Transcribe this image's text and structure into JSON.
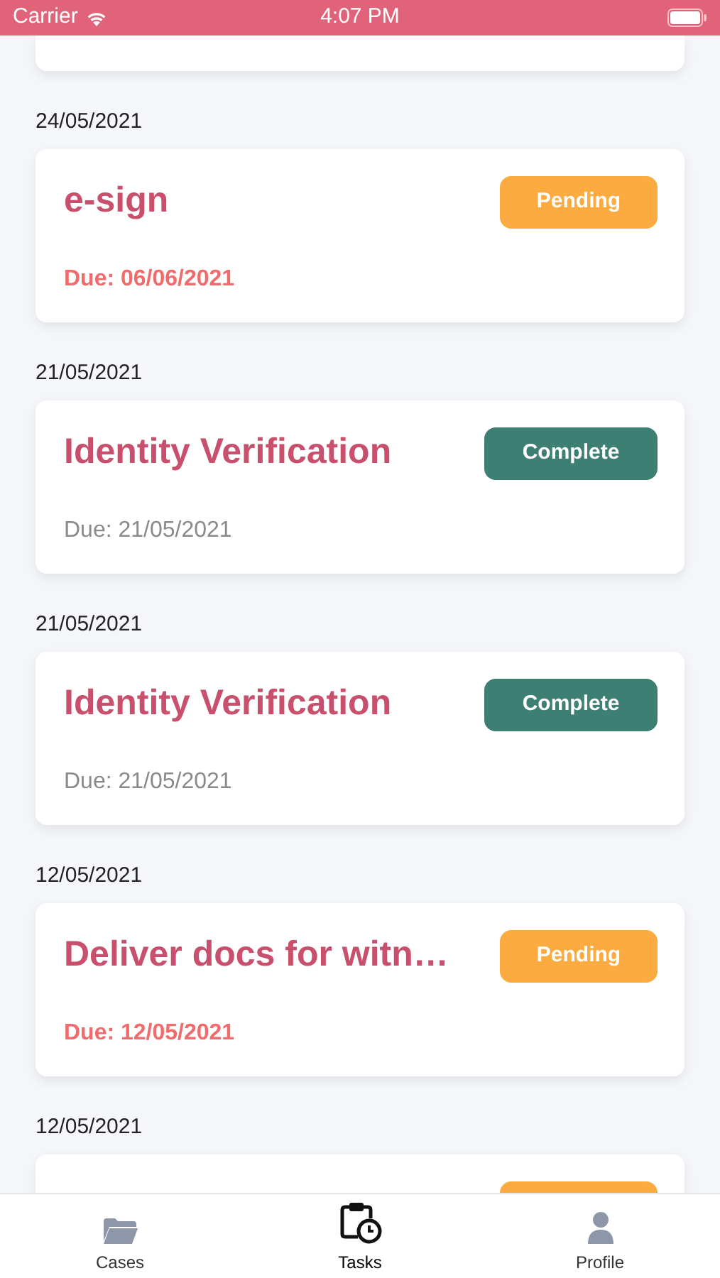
{
  "status_bar": {
    "carrier": "Carrier",
    "time": "4:07 PM"
  },
  "tasks": [
    {
      "date": "24/05/2021",
      "title": "e-sign",
      "kind": "pending",
      "status_label": "Pending",
      "due": "Due: 06/06/2021"
    },
    {
      "date": "21/05/2021",
      "title": "Identity Verification",
      "kind": "complete",
      "status_label": "Complete",
      "due": "Due: 21/05/2021"
    },
    {
      "date": "21/05/2021",
      "title": "Identity Verification",
      "kind": "complete",
      "status_label": "Complete",
      "due": "Due: 21/05/2021"
    },
    {
      "date": "12/05/2021",
      "title": "Deliver docs for witn…",
      "kind": "pending",
      "status_label": "Pending",
      "due": "Due: 12/05/2021"
    },
    {
      "date": "12/05/2021",
      "kind": "pending"
    }
  ],
  "tab_bar": [
    {
      "label": "Cases",
      "kind": "folder",
      "selected": false
    },
    {
      "label": "Tasks",
      "kind": "clipboard",
      "selected": true
    },
    {
      "label": "Profile",
      "kind": "person",
      "selected": false
    }
  ]
}
